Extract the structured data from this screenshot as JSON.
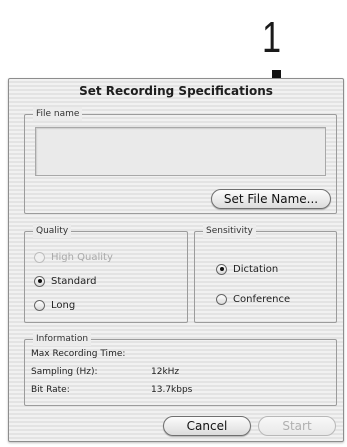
{
  "step_number": "1",
  "dialog": {
    "title": "Set Recording Specifications"
  },
  "file_name_group": {
    "legend": "File name",
    "set_button_label": "Set File Name..."
  },
  "quality_group": {
    "legend": "Quality",
    "options": [
      {
        "label": "High Quality",
        "selected": false,
        "enabled": false
      },
      {
        "label": "Standard",
        "selected": true,
        "enabled": true
      },
      {
        "label": "Long",
        "selected": false,
        "enabled": true
      }
    ]
  },
  "sensitivity_group": {
    "legend": "Sensitivity",
    "options": [
      {
        "label": "Dictation",
        "selected": true
      },
      {
        "label": "Conference",
        "selected": false
      }
    ]
  },
  "information_group": {
    "legend": "Information",
    "rows": [
      {
        "label": "Max Recording Time:",
        "value": ""
      },
      {
        "label": "Sampling (Hz):",
        "value": "12kHz"
      },
      {
        "label": "Bit Rate:",
        "value": "13.7kbps"
      }
    ]
  },
  "buttons": {
    "cancel_label": "Cancel",
    "start_label": "Start"
  }
}
